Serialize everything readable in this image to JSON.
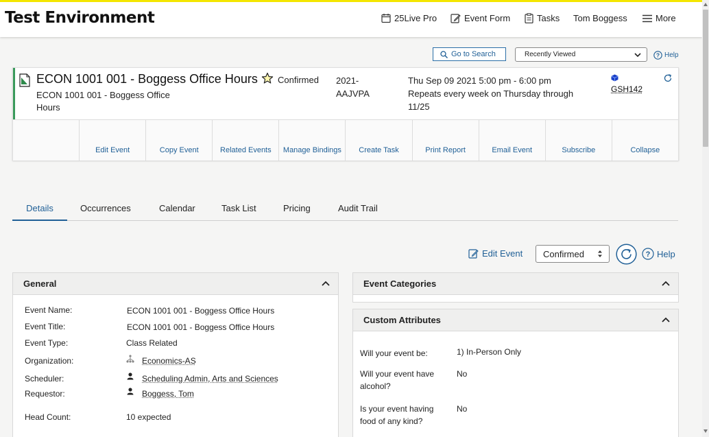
{
  "header": {
    "app_title": "Test Environment",
    "nav": {
      "pro": "25Live Pro",
      "event_form": "Event Form",
      "tasks": "Tasks",
      "user": "Tom Boggess",
      "more": "More"
    }
  },
  "toolbar": {
    "go_to_search": "Go to Search",
    "recently_viewed": "Recently Viewed",
    "help": "Help"
  },
  "event": {
    "name": "ECON 1001 001 - Boggess Office Hours",
    "state": "Confirmed",
    "title": "ECON 1001 001 - Boggess Office Hours",
    "locator": "2021-AAJVPA",
    "date": "Thu Sep 09 2021 5:00 pm - 6:00 pm",
    "repeat": "Repeats every week on Thursday through 11/25",
    "room": "GSH142",
    "actions": [
      "Edit Event",
      "Copy Event",
      "Related Events",
      "Manage Bindings",
      "Create Task",
      "Print Report",
      "Email Event",
      "Subscribe",
      "Collapse"
    ]
  },
  "tabs": [
    "Details",
    "Occurrences",
    "Calendar",
    "Task List",
    "Pricing",
    "Audit Trail"
  ],
  "detail_toolbar": {
    "edit_event": "Edit Event",
    "state": "Confirmed",
    "help": "Help"
  },
  "general": {
    "title": "General",
    "rows": [
      {
        "label": "Event Name:",
        "value": "ECON 1001 001 - Boggess Office Hours"
      },
      {
        "label": "Event Title:",
        "value": "ECON 1001 001 - Boggess Office Hours"
      },
      {
        "label": "Event Type:",
        "value": "Class Related"
      },
      {
        "label": "Organization:",
        "value": "Economics-AS"
      },
      {
        "label": "Scheduler:",
        "value": "Scheduling Admin, Arts and Sciences"
      },
      {
        "label": "Requestor:",
        "value": "Boggess, Tom"
      },
      {
        "label": "Head Count:",
        "value": "10 expected"
      }
    ]
  },
  "event_categories": {
    "title": "Event Categories"
  },
  "custom_attributes": {
    "title": "Custom Attributes",
    "rows": [
      {
        "label": "Will your event be:",
        "value": "1) In-Person Only"
      },
      {
        "label": "Will your event have alcohol?",
        "value": "No"
      },
      {
        "label": "Is your event having food of any kind?",
        "value": "No"
      }
    ]
  },
  "colors": {
    "accent_yellow": "#f4e600",
    "link_blue": "#1f5f96",
    "state_green": "#3a9a5b"
  }
}
